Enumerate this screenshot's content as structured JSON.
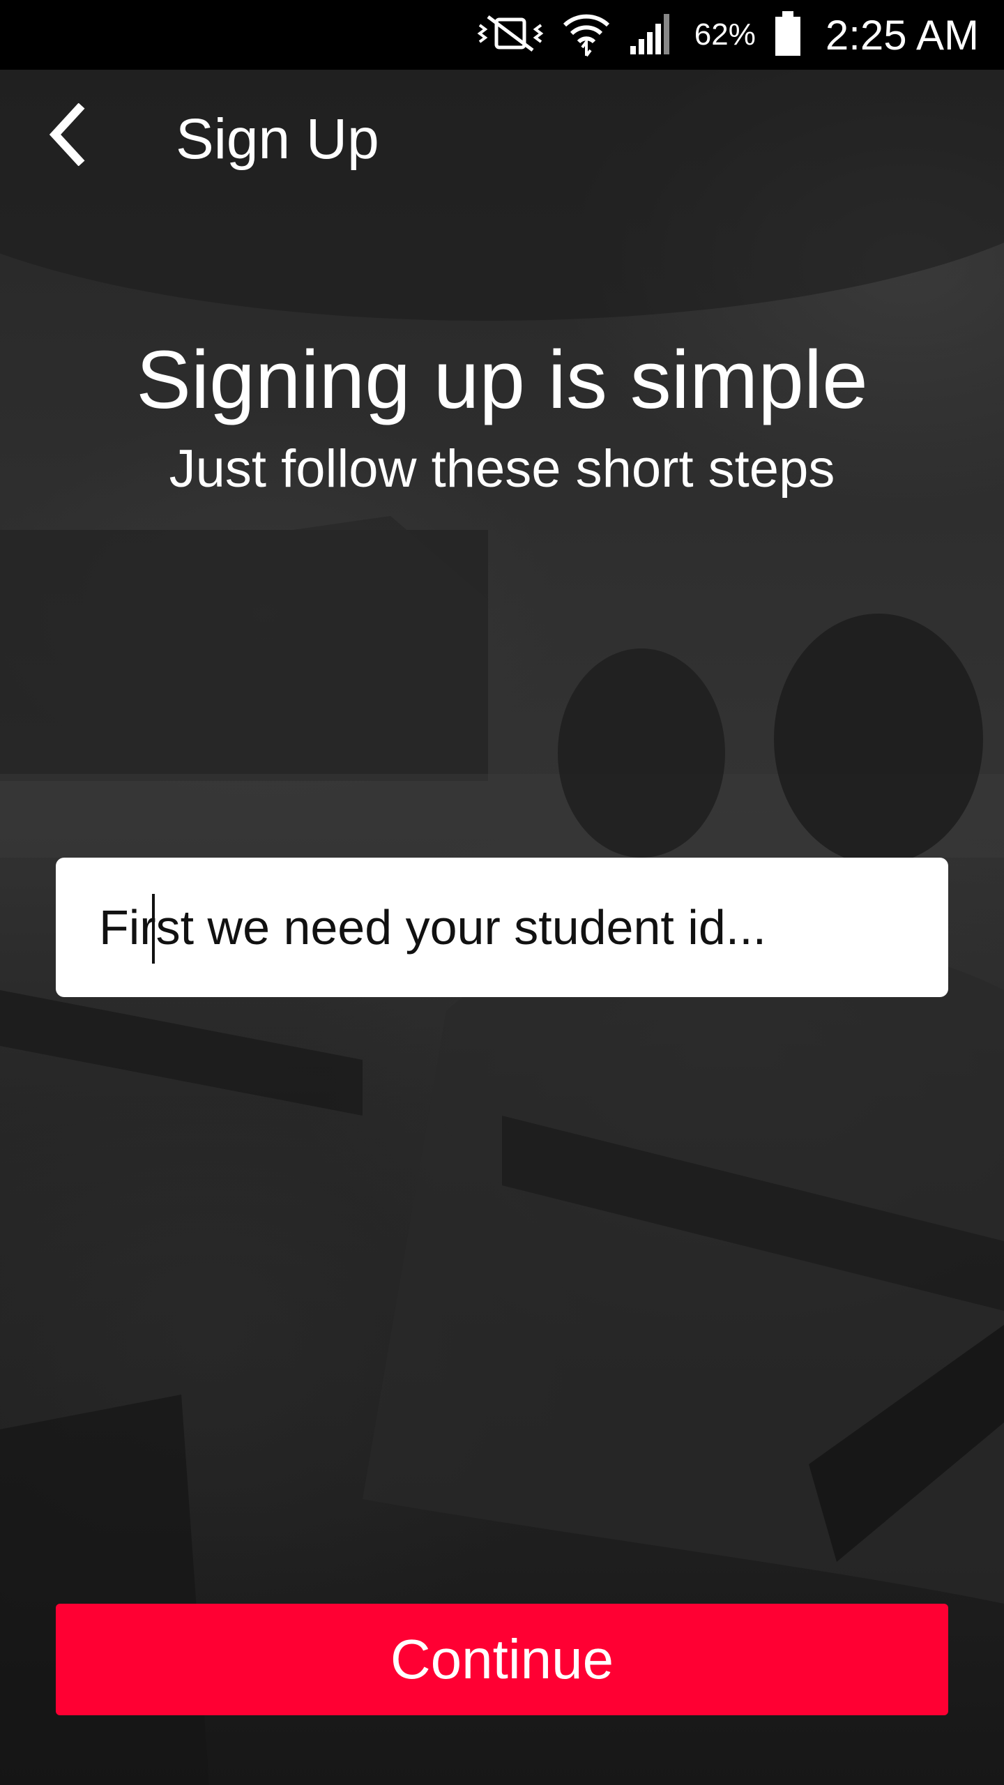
{
  "status_bar": {
    "battery_percent": "62%",
    "time": "2:25 AM",
    "icons": [
      "mute-vibrate-icon",
      "wifi-icon",
      "signal-icon",
      "battery-icon"
    ]
  },
  "app_bar": {
    "back_icon": "chevron-left-icon",
    "title": "Sign Up"
  },
  "content": {
    "headline": "Signing up is simple",
    "subhead": "Just follow these short steps"
  },
  "student_id": {
    "placeholder": "First we need your student id...",
    "value": ""
  },
  "actions": {
    "continue_label": "Continue"
  },
  "colors": {
    "accent": "#ff0033",
    "status_bar_bg": "#000000",
    "text": "#ffffff"
  }
}
